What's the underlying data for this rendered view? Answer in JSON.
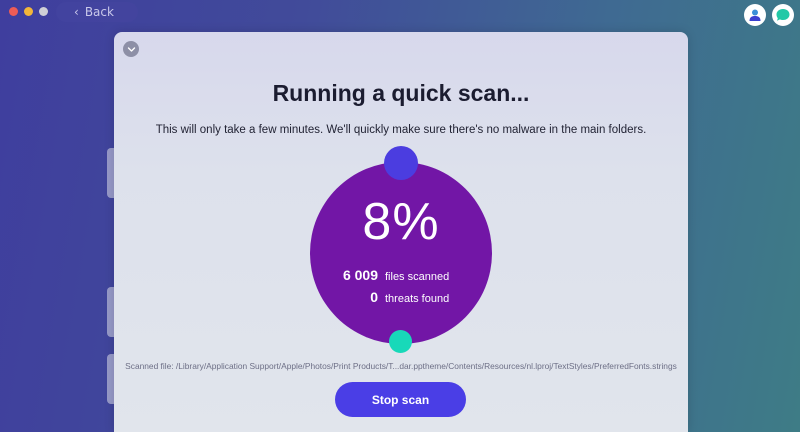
{
  "titlebar": {
    "back_label": "Back"
  },
  "header_icons": [
    "account-icon",
    "chat-assistant-icon"
  ],
  "scan": {
    "title": "Running a quick scan...",
    "description": "This will only take a few minutes. We'll quickly make sure there's no malware in the main folders.",
    "progress_percent": 8,
    "progress_label": "8%",
    "files_scanned_count": "6 009",
    "files_scanned_label": "files scanned",
    "threats_count": "0",
    "threats_label": "threats found",
    "scanned_file": "Scanned file: /Library/Application Support/Apple/Photos/Print Products/T...dar.pptheme/Contents/Resources/nl.lproj/TextStyles/PreferredFonts.strings",
    "stop_button_label": "Stop scan"
  },
  "colors": {
    "progress_circle": "#7216a6",
    "progress_start_knob": "#4b3de0",
    "progress_end_knob": "#18d9b9",
    "primary_button": "#4a3ee6"
  }
}
